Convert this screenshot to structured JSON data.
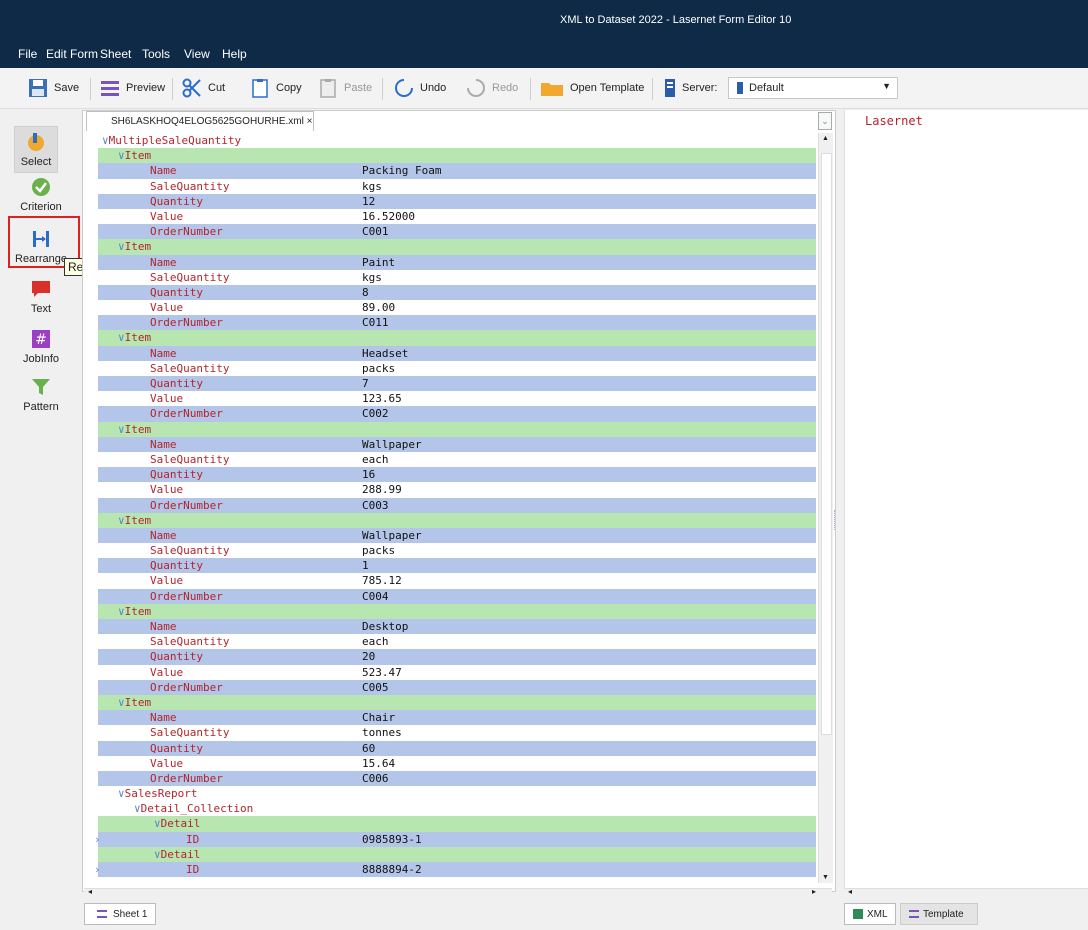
{
  "window": {
    "title": "XML to Dataset 2022 - Lasernet Form Editor 10"
  },
  "menu": [
    "File",
    "Edit",
    "Form",
    "Sheet",
    "Tools",
    "View",
    "Help"
  ],
  "toolbar": {
    "save": "Save",
    "preview": "Preview",
    "cut": "Cut",
    "copy": "Copy",
    "paste": "Paste",
    "undo": "Undo",
    "redo": "Redo",
    "open_template": "Open Template",
    "server_label": "Server:",
    "server_value": "Default"
  },
  "tools": {
    "select": "Select",
    "criterion": "Criterion",
    "rearrange": "Rearrange",
    "text": "Text",
    "jobinfo": "JobInfo",
    "pattern": "Pattern",
    "tooltip": "Rearrange"
  },
  "editor": {
    "file_tab": "SH6LASKHOQ4ELOG5625GOHURHE.xml ×",
    "root": "MultipleSaleQuantity",
    "item_label": "Item",
    "fields": [
      "Name",
      "SaleQuantity",
      "Quantity",
      "Value",
      "OrderNumber"
    ],
    "items": [
      [
        "Packing Foam",
        "kgs",
        "12",
        "16.52000",
        "C001"
      ],
      [
        "Paint",
        "kgs",
        "8",
        "89.00",
        "C011"
      ],
      [
        "Headset",
        "packs",
        "7",
        "123.65",
        "C002"
      ],
      [
        "Wallpaper",
        "each",
        "16",
        "288.99",
        "C003"
      ],
      [
        "Wallpaper",
        "packs",
        "1",
        "785.12",
        "C004"
      ],
      [
        "Desktop",
        "each",
        "20",
        "523.47",
        "C005"
      ],
      [
        "Chair",
        "tonnes",
        "60",
        "15.64",
        "C006"
      ]
    ],
    "sales_report": "SalesReport",
    "detail_collection": "Detail_Collection",
    "detail_label": "Detail",
    "id_label": "ID",
    "details": [
      "0985893-1",
      "8888894-2"
    ]
  },
  "right_pane": {
    "text": "Lasernet"
  },
  "bottom": {
    "sheet_tab": "Sheet 1",
    "xml_tab": "XML",
    "template_tab": "Template"
  },
  "colors": {
    "titlebar": "#0e2a47",
    "green_row": "#b8e6b0",
    "blue_row": "#b3c5e8",
    "element_text": "#b3252b",
    "highlight_box": "#e02020"
  }
}
